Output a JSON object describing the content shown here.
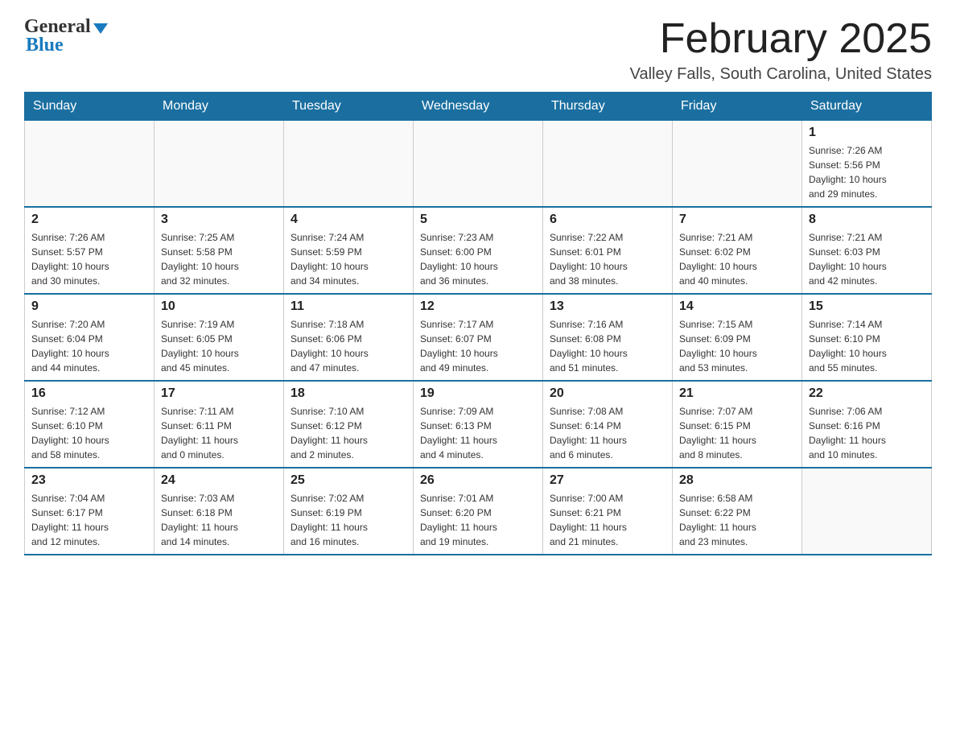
{
  "logo": {
    "text_general": "General",
    "text_blue": "Blue"
  },
  "header": {
    "title": "February 2025",
    "subtitle": "Valley Falls, South Carolina, United States"
  },
  "weekdays": [
    "Sunday",
    "Monday",
    "Tuesday",
    "Wednesday",
    "Thursday",
    "Friday",
    "Saturday"
  ],
  "weeks": [
    [
      {
        "day": "",
        "info": ""
      },
      {
        "day": "",
        "info": ""
      },
      {
        "day": "",
        "info": ""
      },
      {
        "day": "",
        "info": ""
      },
      {
        "day": "",
        "info": ""
      },
      {
        "day": "",
        "info": ""
      },
      {
        "day": "1",
        "info": "Sunrise: 7:26 AM\nSunset: 5:56 PM\nDaylight: 10 hours\nand 29 minutes."
      }
    ],
    [
      {
        "day": "2",
        "info": "Sunrise: 7:26 AM\nSunset: 5:57 PM\nDaylight: 10 hours\nand 30 minutes."
      },
      {
        "day": "3",
        "info": "Sunrise: 7:25 AM\nSunset: 5:58 PM\nDaylight: 10 hours\nand 32 minutes."
      },
      {
        "day": "4",
        "info": "Sunrise: 7:24 AM\nSunset: 5:59 PM\nDaylight: 10 hours\nand 34 minutes."
      },
      {
        "day": "5",
        "info": "Sunrise: 7:23 AM\nSunset: 6:00 PM\nDaylight: 10 hours\nand 36 minutes."
      },
      {
        "day": "6",
        "info": "Sunrise: 7:22 AM\nSunset: 6:01 PM\nDaylight: 10 hours\nand 38 minutes."
      },
      {
        "day": "7",
        "info": "Sunrise: 7:21 AM\nSunset: 6:02 PM\nDaylight: 10 hours\nand 40 minutes."
      },
      {
        "day": "8",
        "info": "Sunrise: 7:21 AM\nSunset: 6:03 PM\nDaylight: 10 hours\nand 42 minutes."
      }
    ],
    [
      {
        "day": "9",
        "info": "Sunrise: 7:20 AM\nSunset: 6:04 PM\nDaylight: 10 hours\nand 44 minutes."
      },
      {
        "day": "10",
        "info": "Sunrise: 7:19 AM\nSunset: 6:05 PM\nDaylight: 10 hours\nand 45 minutes."
      },
      {
        "day": "11",
        "info": "Sunrise: 7:18 AM\nSunset: 6:06 PM\nDaylight: 10 hours\nand 47 minutes."
      },
      {
        "day": "12",
        "info": "Sunrise: 7:17 AM\nSunset: 6:07 PM\nDaylight: 10 hours\nand 49 minutes."
      },
      {
        "day": "13",
        "info": "Sunrise: 7:16 AM\nSunset: 6:08 PM\nDaylight: 10 hours\nand 51 minutes."
      },
      {
        "day": "14",
        "info": "Sunrise: 7:15 AM\nSunset: 6:09 PM\nDaylight: 10 hours\nand 53 minutes."
      },
      {
        "day": "15",
        "info": "Sunrise: 7:14 AM\nSunset: 6:10 PM\nDaylight: 10 hours\nand 55 minutes."
      }
    ],
    [
      {
        "day": "16",
        "info": "Sunrise: 7:12 AM\nSunset: 6:10 PM\nDaylight: 10 hours\nand 58 minutes."
      },
      {
        "day": "17",
        "info": "Sunrise: 7:11 AM\nSunset: 6:11 PM\nDaylight: 11 hours\nand 0 minutes."
      },
      {
        "day": "18",
        "info": "Sunrise: 7:10 AM\nSunset: 6:12 PM\nDaylight: 11 hours\nand 2 minutes."
      },
      {
        "day": "19",
        "info": "Sunrise: 7:09 AM\nSunset: 6:13 PM\nDaylight: 11 hours\nand 4 minutes."
      },
      {
        "day": "20",
        "info": "Sunrise: 7:08 AM\nSunset: 6:14 PM\nDaylight: 11 hours\nand 6 minutes."
      },
      {
        "day": "21",
        "info": "Sunrise: 7:07 AM\nSunset: 6:15 PM\nDaylight: 11 hours\nand 8 minutes."
      },
      {
        "day": "22",
        "info": "Sunrise: 7:06 AM\nSunset: 6:16 PM\nDaylight: 11 hours\nand 10 minutes."
      }
    ],
    [
      {
        "day": "23",
        "info": "Sunrise: 7:04 AM\nSunset: 6:17 PM\nDaylight: 11 hours\nand 12 minutes."
      },
      {
        "day": "24",
        "info": "Sunrise: 7:03 AM\nSunset: 6:18 PM\nDaylight: 11 hours\nand 14 minutes."
      },
      {
        "day": "25",
        "info": "Sunrise: 7:02 AM\nSunset: 6:19 PM\nDaylight: 11 hours\nand 16 minutes."
      },
      {
        "day": "26",
        "info": "Sunrise: 7:01 AM\nSunset: 6:20 PM\nDaylight: 11 hours\nand 19 minutes."
      },
      {
        "day": "27",
        "info": "Sunrise: 7:00 AM\nSunset: 6:21 PM\nDaylight: 11 hours\nand 21 minutes."
      },
      {
        "day": "28",
        "info": "Sunrise: 6:58 AM\nSunset: 6:22 PM\nDaylight: 11 hours\nand 23 minutes."
      },
      {
        "day": "",
        "info": ""
      }
    ]
  ]
}
